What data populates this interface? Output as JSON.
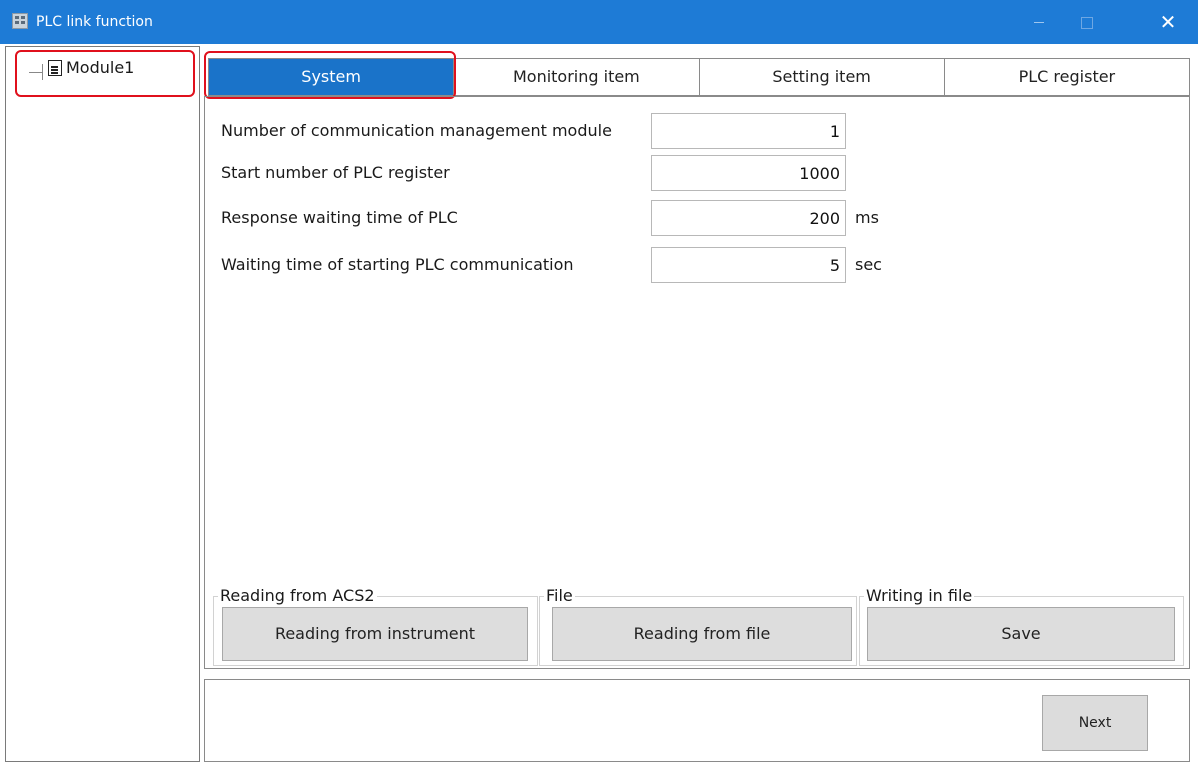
{
  "window": {
    "title": "PLC link function",
    "minimize_glyph": "",
    "maximize_glyph": "",
    "close_glyph": "✕"
  },
  "tree": {
    "items": [
      {
        "label": "Module1",
        "icon": "document-icon"
      }
    ]
  },
  "tabs": [
    {
      "label": "System",
      "active": true
    },
    {
      "label": "Monitoring item",
      "active": false
    },
    {
      "label": "Setting item",
      "active": false
    },
    {
      "label": "PLC register",
      "active": false
    }
  ],
  "system": {
    "fields": [
      {
        "label": "Number of communication management module",
        "value": "1",
        "unit": ""
      },
      {
        "label": "Start number of PLC register",
        "value": "1000",
        "unit": ""
      },
      {
        "label": "Response waiting time of PLC",
        "value": "200",
        "unit": "ms"
      },
      {
        "label": "Waiting time of starting PLC communication",
        "value": "5",
        "unit": "sec"
      }
    ]
  },
  "groups": [
    {
      "legend": "Reading from ACS2",
      "button": "Reading from instrument"
    },
    {
      "legend": "File",
      "button": "Reading from file"
    },
    {
      "legend": "Writing in file",
      "button": "Save"
    }
  ],
  "footer": {
    "next_label": "Next"
  },
  "colors": {
    "titlebar": "#1e7bd6",
    "active_tab": "#1a73c9",
    "highlight": "#e0101c",
    "button_bg": "#dddddd"
  }
}
